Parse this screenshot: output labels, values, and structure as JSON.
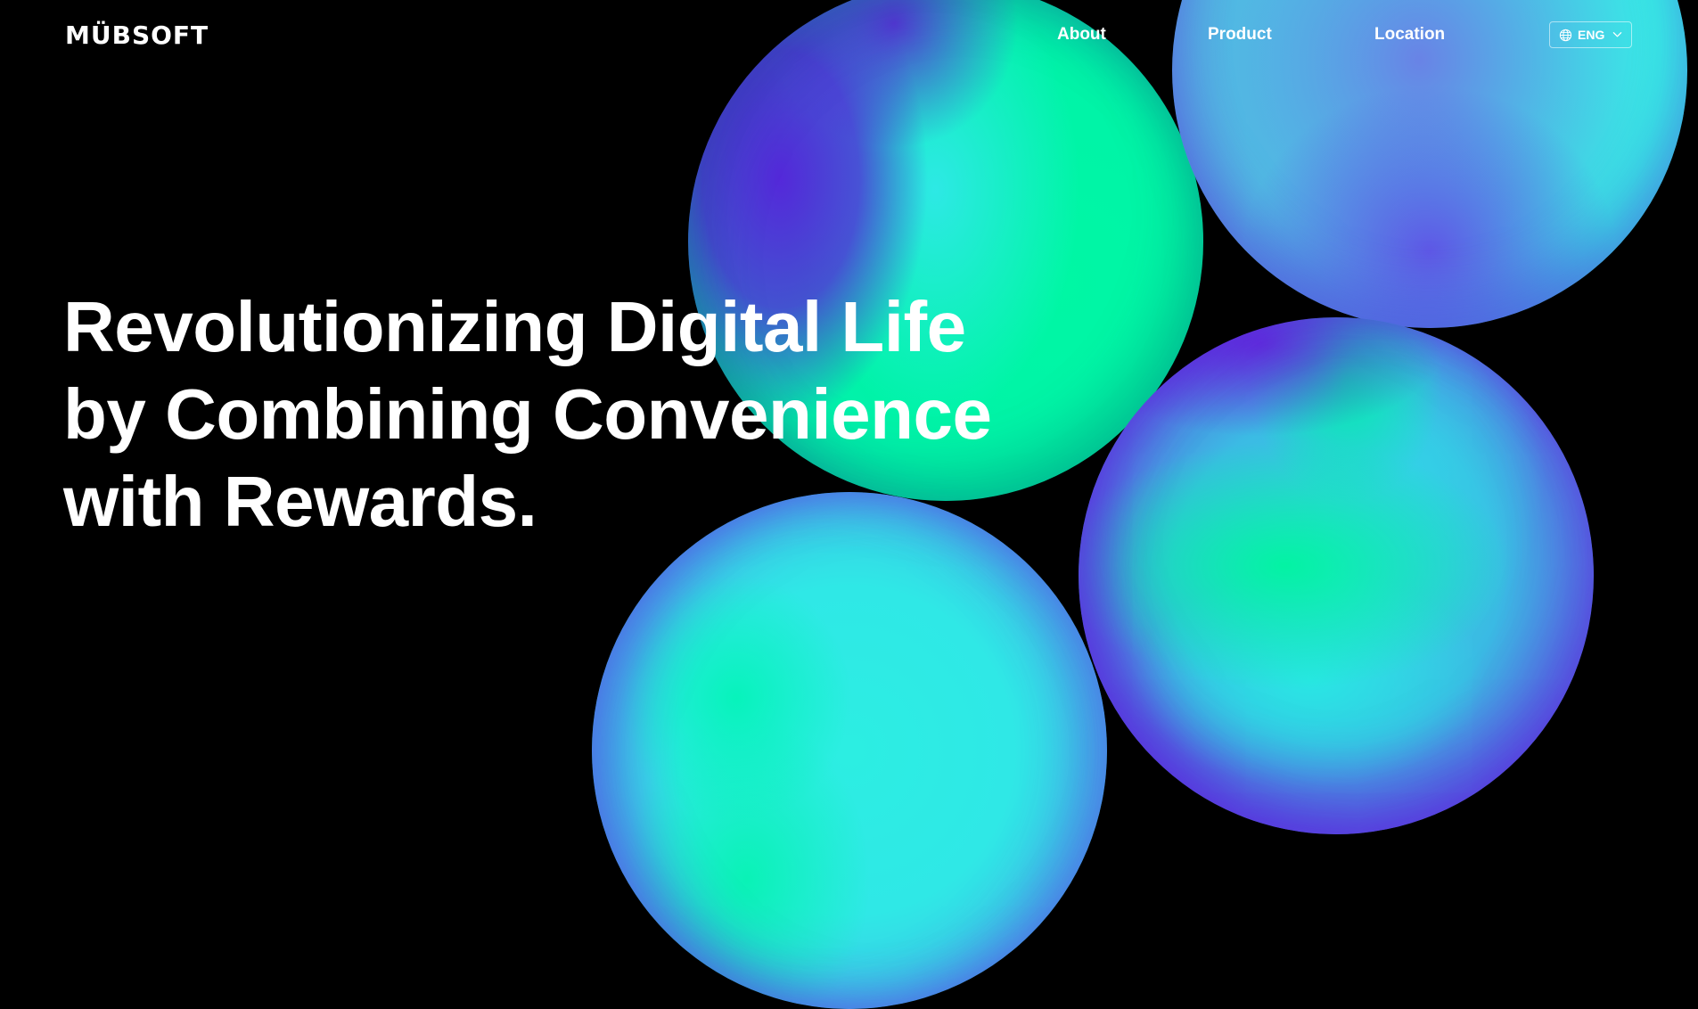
{
  "header": {
    "logo_text": "MÜBSOFT",
    "nav": {
      "about": "About",
      "product": "Product",
      "location": "Location"
    },
    "language": {
      "icon": "globe-icon",
      "selected": "ENG",
      "chevron": "chevron-down-icon"
    }
  },
  "hero": {
    "title_lines": [
      "Revolutionizing Digital Life",
      "by Combining Convenience",
      "with Rewards."
    ]
  },
  "colors": {
    "background": "#000000",
    "text": "#ffffff",
    "sphere_green": "#00f3a8",
    "sphere_cyan": "#2fe8e6",
    "sphere_violet": "#5a24dc"
  }
}
